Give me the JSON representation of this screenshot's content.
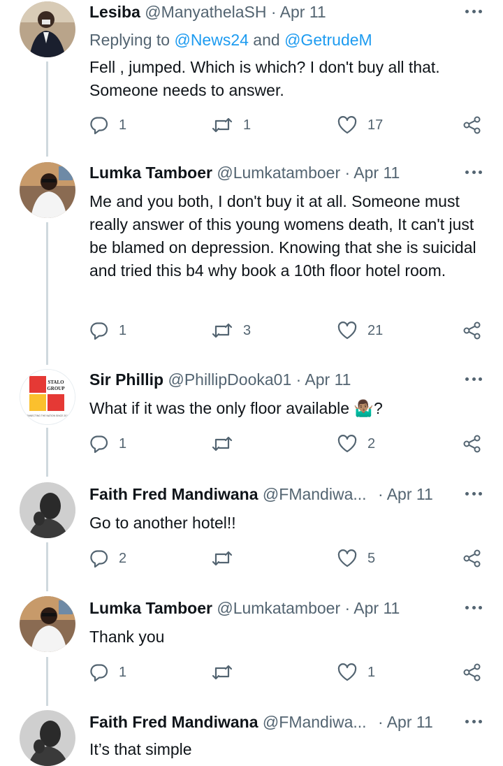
{
  "tweets": [
    {
      "name": "Lesiba",
      "handle": "@ManyathelaSH",
      "date": "· Apr 11",
      "reply_prefix": "Replying to ",
      "reply_mention1": "@News24",
      "reply_and": " and ",
      "reply_mention2": "@GetrudeM",
      "text": "Fell , jumped. Which is which? I don't buy all that. Someone needs to answer.",
      "replies": "1",
      "retweets": "1",
      "likes": "17"
    },
    {
      "name": "Lumka Tamboer",
      "handle": "@Lumkatamboer",
      "date": "· Apr 11",
      "text": "Me and you both, I don't buy it at all. Someone must really answer of this young womens death, It can't just be blamed on depression. Knowing that she is suicidal and tried this b4 why book a 10th floor hotel room.",
      "replies": "1",
      "retweets": "3",
      "likes": "21"
    },
    {
      "name": "Sir Phillip",
      "handle": "@PhillipDooka01",
      "date": "· Apr 11",
      "text": "What if it was the only floor available 🤷🏽‍♂️?",
      "replies": "1",
      "retweets": "",
      "likes": "2",
      "avatar_logo_line1": "STALO",
      "avatar_logo_line2": "GROUP",
      "avatar_logo_tagline": "CONNECTING THE NATION SINCE 2016"
    },
    {
      "name": "Faith Fred Mandiwana",
      "handle": "@FMandiwa...",
      "date": "· Apr 11",
      "text": "Go to another hotel!!",
      "replies": "2",
      "retweets": "",
      "likes": "5"
    },
    {
      "name": "Lumka Tamboer",
      "handle": "@Lumkatamboer",
      "date": "· Apr 11",
      "text": "Thank you",
      "replies": "1",
      "retweets": "",
      "likes": "1"
    },
    {
      "name": "Faith Fred Mandiwana",
      "handle": "@FMandiwa...",
      "date": "· Apr 11",
      "text": "It’s that simple"
    }
  ],
  "icons": {
    "reply": "reply-icon",
    "retweet": "retweet-icon",
    "like": "heart-icon",
    "share": "share-icon",
    "more": "more-options-icon"
  },
  "colors": {
    "text": "#0f1419",
    "secondary": "#536471",
    "mention": "#1d9bf0",
    "thread_line": "#cfd9de"
  }
}
